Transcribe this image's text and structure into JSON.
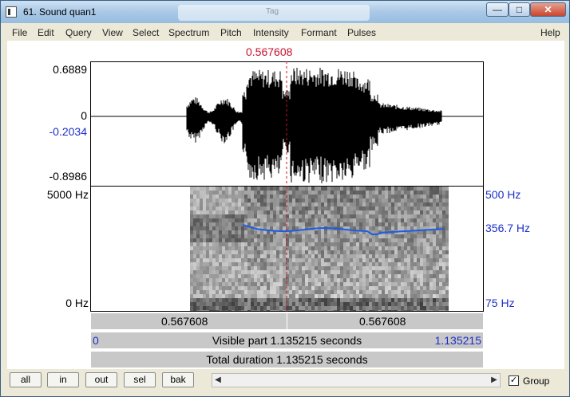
{
  "window": {
    "title": "61. Sound quan1",
    "title_ghost": "Tag",
    "controls": {
      "minimize": "—",
      "maximize": "□",
      "close": "✕"
    }
  },
  "menu": [
    "File",
    "Edit",
    "Query",
    "View",
    "Select",
    "Spectrum",
    "Pitch",
    "Intensity",
    "Formant",
    "Pulses",
    "Help"
  ],
  "editor": {
    "cursor_time": "0.567608",
    "waveform": {
      "max": "0.6889",
      "zero": "0",
      "cursor_value": "-0.2034",
      "min": "-0.8986"
    },
    "spectrogram": {
      "top_freq": "5000 Hz",
      "bottom_freq": "0 Hz"
    },
    "pitch": {
      "top": "500 Hz",
      "cursor": "356.7 Hz",
      "bottom": "75 Hz",
      "color": "#1a5ee6"
    },
    "cursor_color": "#c8102e",
    "selection_bar": {
      "left": "0.567608",
      "right": "0.567608"
    },
    "visible_bar": {
      "start": "0",
      "text": "Visible part 1.135215 seconds",
      "end": "1.135215"
    },
    "total_bar": {
      "text": "Total duration 1.135215 seconds"
    }
  },
  "buttons": {
    "all": "all",
    "in": "in",
    "out": "out",
    "sel": "sel",
    "bak": "bak"
  },
  "scroll": {
    "left_arrow": "◀",
    "right_arrow": "▶"
  },
  "group": {
    "label": "Group",
    "checked": true,
    "mark": "✓"
  }
}
